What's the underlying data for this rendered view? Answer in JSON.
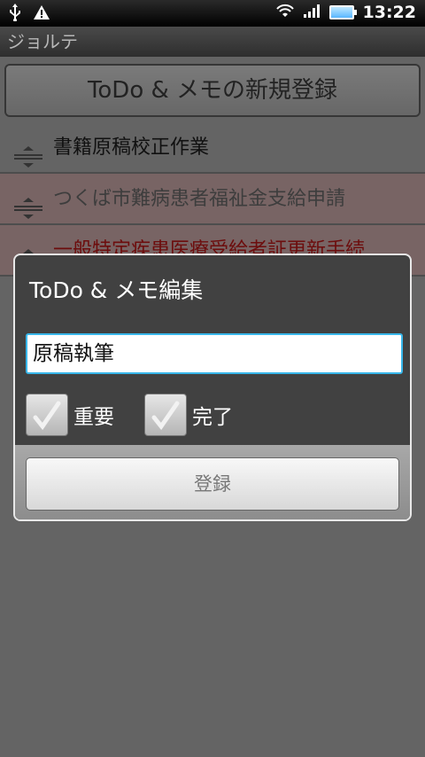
{
  "status_bar": {
    "icons": [
      "usb-icon",
      "warning-icon",
      "wifi-icon",
      "signal-icon",
      "battery-icon"
    ],
    "time": "13:22"
  },
  "app": {
    "title": "ジョルテ"
  },
  "main": {
    "new_button_label": "ToDo & メモの新規登録",
    "items": [
      {
        "text": "書籍原稿校正作業",
        "style": "normal"
      },
      {
        "text": "つくば市難病患者福祉金支給申請",
        "style": "pink"
      },
      {
        "text": "一般特定疾患医療受給者証更新手続",
        "style": "pink-red"
      }
    ]
  },
  "dialog": {
    "title": "ToDo & メモ編集",
    "input_value": "原稿執筆",
    "checkboxes": [
      {
        "label": "重要",
        "checked": false
      },
      {
        "label": "完了",
        "checked": false
      }
    ],
    "submit_label": "登録"
  },
  "colors": {
    "input_focus": "#38b7ea",
    "pink_row": "#f0c8c8",
    "red_text": "#d81a1a"
  }
}
